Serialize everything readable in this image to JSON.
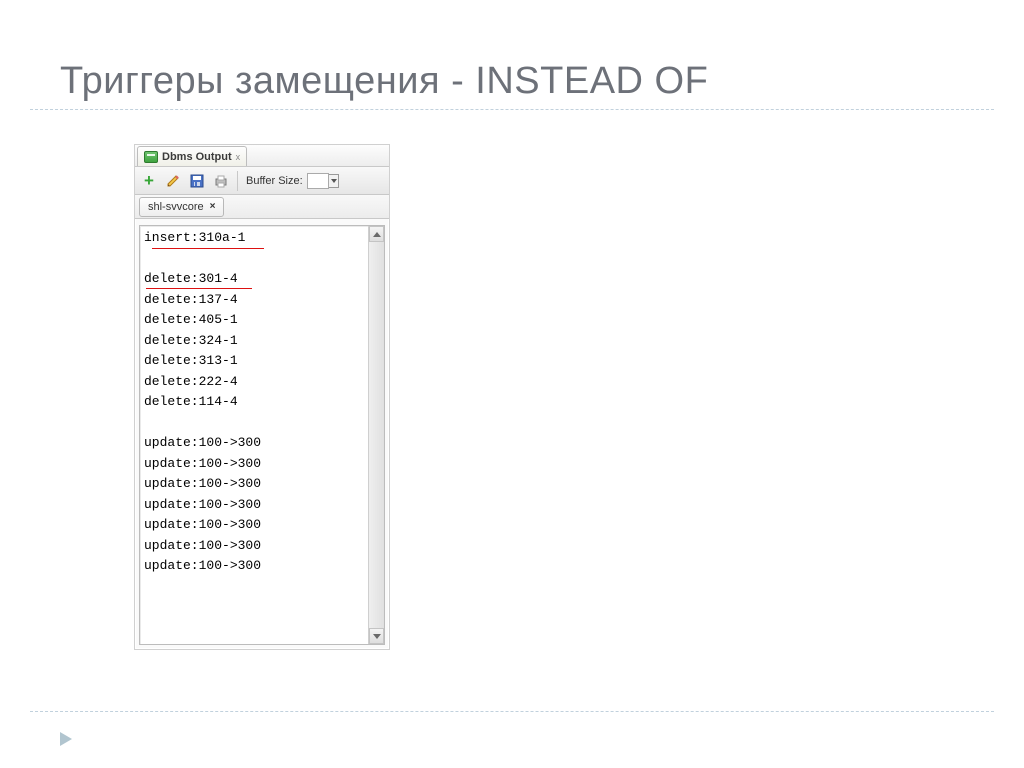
{
  "slide": {
    "title": "Триггеры замещения - INSTEAD OF"
  },
  "panel": {
    "tab_title": "Dbms Output",
    "buffer_label": "Buffer Size:",
    "connection_name": "shl-svvcore"
  },
  "output": {
    "lines": [
      "insert:310a-1",
      "",
      "delete:301-4",
      "delete:137-4",
      "delete:405-1",
      "delete:324-1",
      "delete:313-1",
      "delete:222-4",
      "delete:114-4",
      "",
      "update:100->300",
      "update:100->300",
      "update:100->300",
      "update:100->300",
      "update:100->300",
      "update:100->300",
      "update:100->300"
    ]
  }
}
